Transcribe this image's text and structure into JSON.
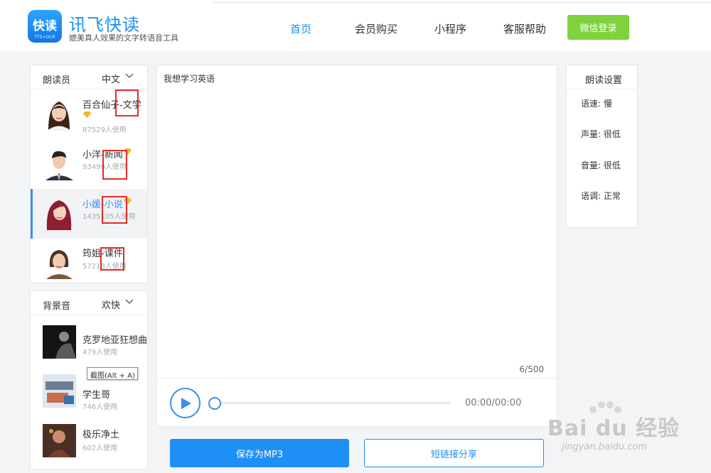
{
  "header": {
    "logo_text": "快读",
    "logo_subtext": "TTS+OCR",
    "brand": "讯飞快读",
    "slogan": "媲美真人效果的文字转语音工具",
    "nav": [
      "首页",
      "会员购买",
      "小程序",
      "客服帮助"
    ],
    "login_label": "微信登录"
  },
  "readers": {
    "title": "朗读员",
    "language": "中文",
    "items": [
      {
        "name": "百合仙子-文学",
        "usage": "87529人使用",
        "premium": true
      },
      {
        "name": "小洋-新闻",
        "usage": "93499人使用",
        "premium": true
      },
      {
        "name": "小媛-小说",
        "usage": "1435105人使用",
        "premium": true,
        "selected": true
      },
      {
        "name": "筠姐-课件",
        "usage": "57218人使用",
        "premium": false
      }
    ]
  },
  "background_music": {
    "title": "背景音",
    "mood": "欢快",
    "items": [
      {
        "name": "克罗地亚狂想曲",
        "usage": "479人使用"
      },
      {
        "name": "学生哥",
        "usage": "746人使用"
      },
      {
        "name": "极乐净土",
        "usage": "602人使用"
      }
    ]
  },
  "tooltip": "截图(Alt + A)",
  "editor": {
    "text": "我想学习英语",
    "counter": "6/500"
  },
  "player": {
    "time": "00:00/00:00",
    "progress": 0
  },
  "settings": {
    "title": "朗读设置",
    "items": [
      "语速: 慢",
      "声量: 很低",
      "音量: 很低",
      "语调: 正常"
    ]
  },
  "actions": {
    "save_label": "保存为MP3",
    "share_label": "短链接分享"
  },
  "watermark": {
    "main": "Bai du 经验",
    "url": "jingyan.baidu.com"
  },
  "colors": {
    "accent": "#1e8ff5",
    "login": "#7ed23e",
    "premium": "#f5b820",
    "highlight_box": "#e52a2a"
  }
}
